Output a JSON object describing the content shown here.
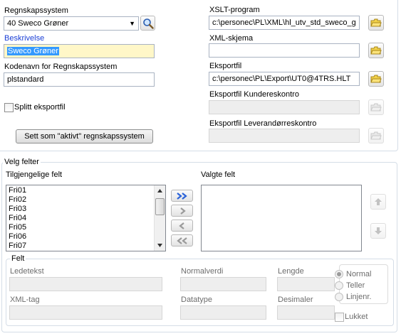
{
  "left": {
    "regnskapssystem_label": "Regnskapssystem",
    "regnskapssystem_value": "40 Sweco Grøner",
    "beskrivelse_label": "Beskrivelse",
    "beskrivelse_value": "Sweco Grøner",
    "kodenavn_label": "Kodenavn for Regnskapssystem",
    "kodenavn_value": "plstandard",
    "splitt_label": "Splitt eksportfil",
    "aktivt_button": "Sett som \"aktivt\" regnskapssystem"
  },
  "right": {
    "xslt_label": "XSLT-program",
    "xslt_value": "c:\\personec\\PL\\XML\\hl_utv_std_sweco_g",
    "xml_label": "XML-skjema",
    "xml_value": "",
    "eksportfil_label": "Eksportfil",
    "eksportfil_value": "c:\\personec\\PL\\Export\\UT0@4TRS.HLT",
    "kunde_label": "Eksportfil Kundereskontro",
    "kunde_value": "",
    "lev_label": "Eksportfil Leverandørreskontro",
    "lev_value": ""
  },
  "velg": {
    "title": "Velg felter",
    "tilgjengelige_label": "Tilgjengelige felt",
    "valgte_label": "Valgte felt",
    "items": [
      "Fri01",
      "Fri02",
      "Fri03",
      "Fri04",
      "Fri05",
      "Fri06",
      "Fri07"
    ]
  },
  "felt": {
    "title": "Felt",
    "ledetekst_label": "Ledetekst",
    "normalverdi_label": "Normalverdi",
    "lengde_label": "Lengde",
    "xmltag_label": "XML-tag",
    "datatype_label": "Datatype",
    "desimaler_label": "Desimaler",
    "radio_normal": "Normal",
    "radio_teller": "Teller",
    "radio_linjenr": "Linjenr.",
    "lukket_label": "Lukket"
  },
  "icons": {
    "search": "magnifier-icon",
    "folder": "folder-icon",
    "move_all_right": "double-chevron-right-icon",
    "move_right": "chevron-right-icon",
    "move_left": "chevron-left-icon",
    "move_all_left": "double-chevron-left-icon",
    "up": "arrow-up-icon",
    "down": "arrow-down-icon"
  },
  "colors": {
    "highlight_label": "#1a3fd6",
    "selection": "#3399ff",
    "yellow_field": "#fff7c8",
    "arrow_blue": "#2b63d9"
  }
}
